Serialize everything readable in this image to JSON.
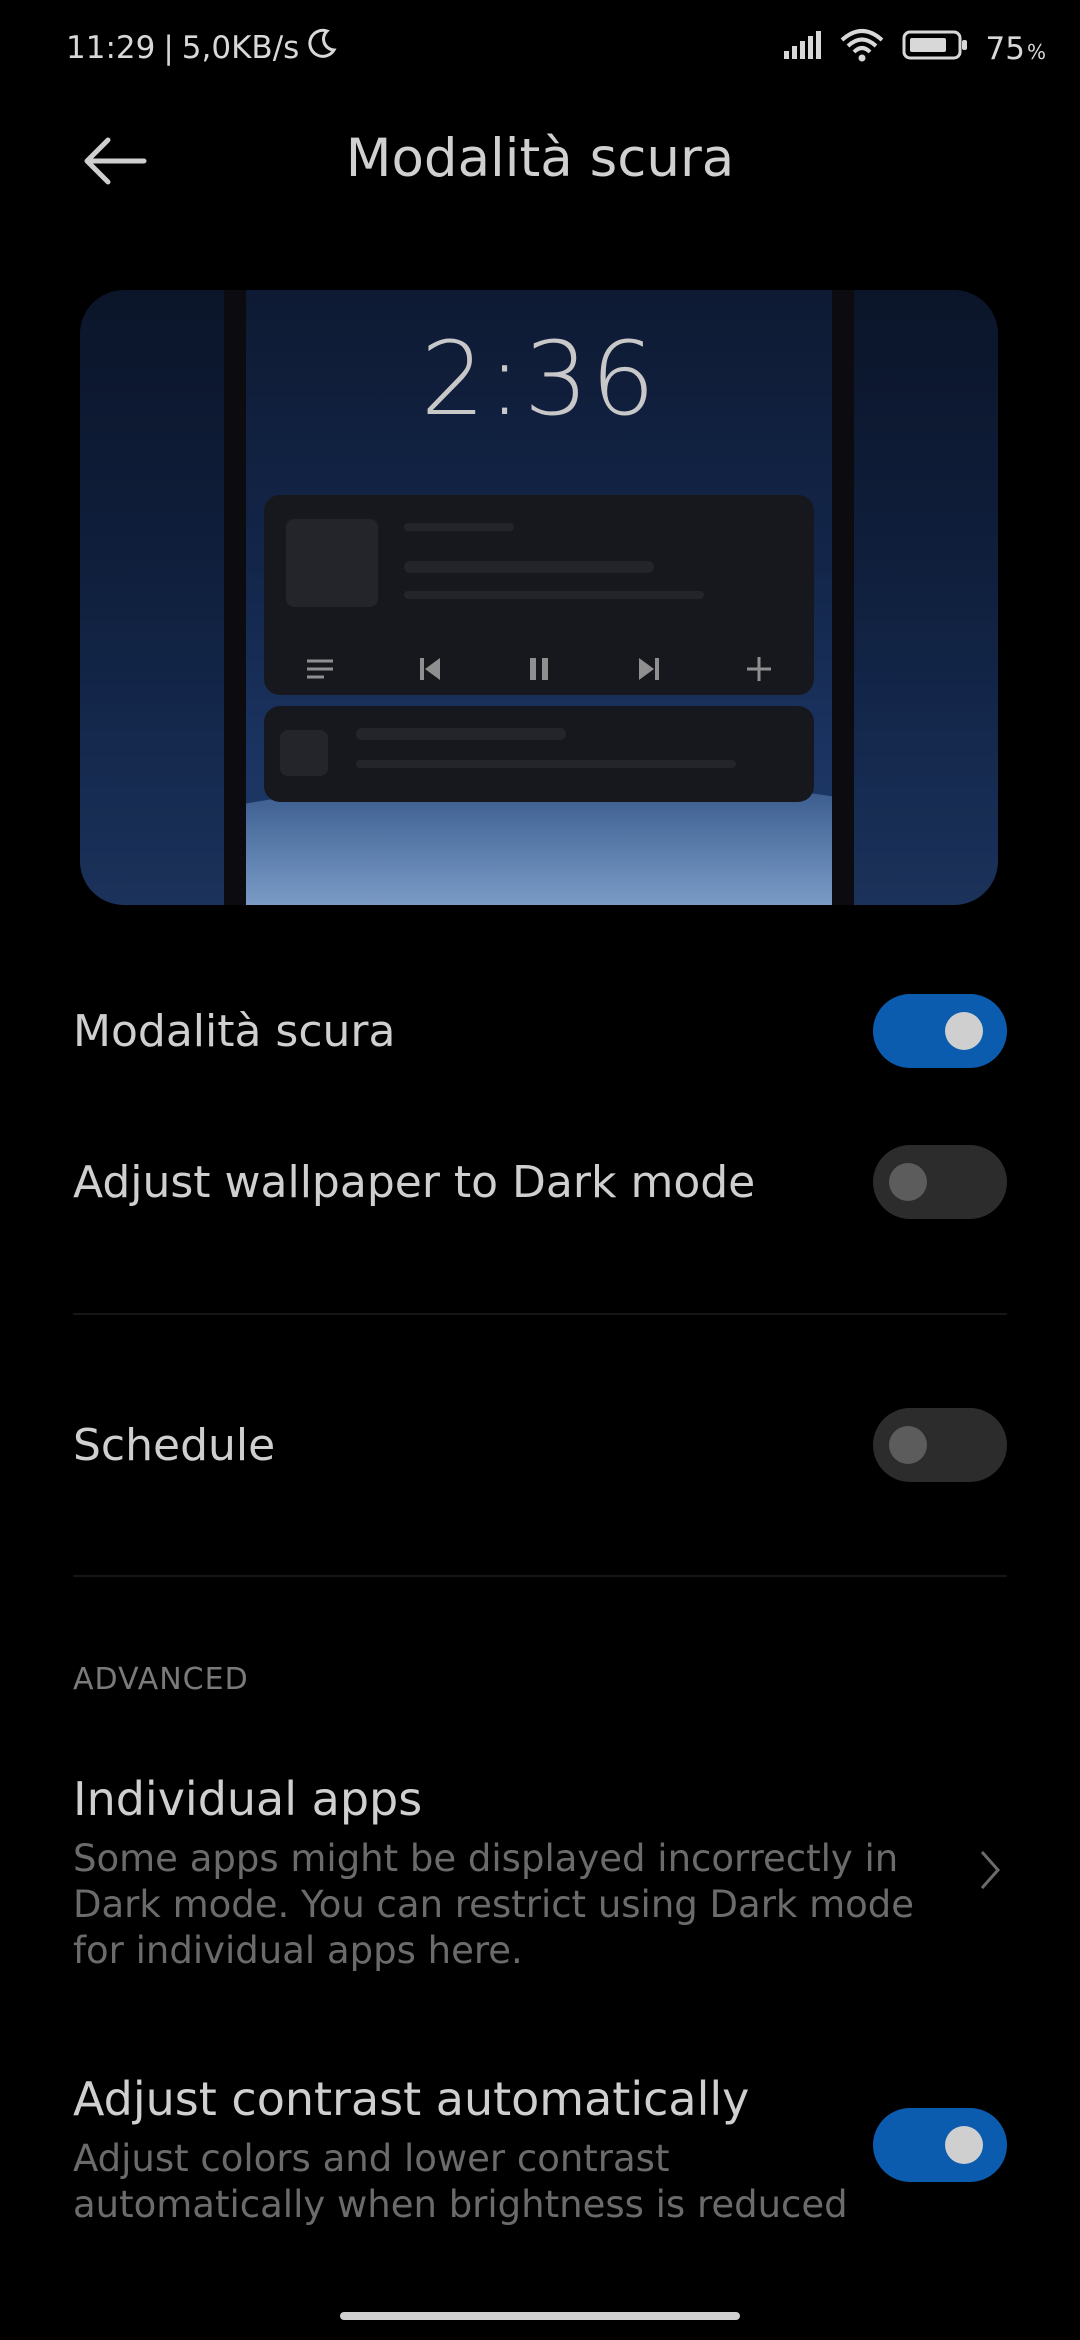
{
  "status_bar": {
    "time": "11:29",
    "separator": "|",
    "speed": "5,0KB/s",
    "battery": "75",
    "battery_unit": "%"
  },
  "header": {
    "title": "Modalità scura"
  },
  "preview": {
    "clock": "2:36"
  },
  "settings": {
    "dark_mode": {
      "label": "Modalità scura",
      "enabled": true
    },
    "adjust_wallpaper": {
      "label": "Adjust wallpaper to Dark mode",
      "enabled": false
    },
    "schedule": {
      "label": "Schedule",
      "enabled": false
    }
  },
  "advanced": {
    "header": "ADVANCED",
    "individual_apps": {
      "title": "Individual apps",
      "description": "Some apps might be displayed incorrectly in Dark mode. You can restrict using Dark mode for individual apps here."
    },
    "adjust_contrast": {
      "title": "Adjust contrast automatically",
      "description": "Adjust colors and lower contrast automatically when brightness is reduced",
      "enabled": true
    }
  },
  "colors": {
    "background": "#000000",
    "toggle_on": "#0b5cae",
    "toggle_off": "#2c2c2c",
    "text_primary": "#cfcfcf",
    "text_secondary": "#6b6b6b"
  }
}
